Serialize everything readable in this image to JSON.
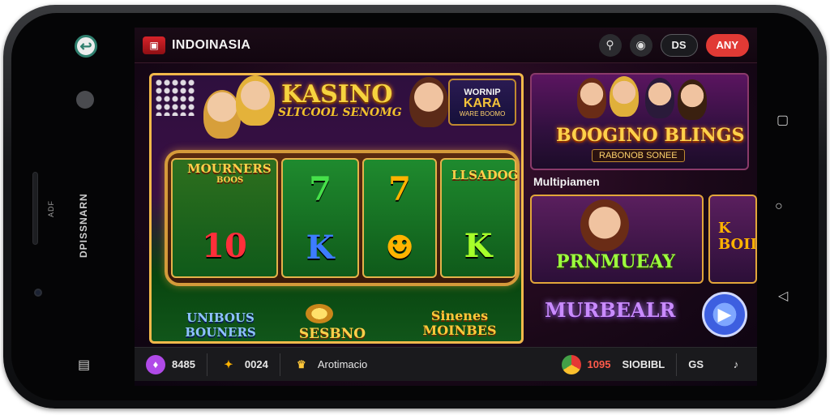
{
  "colors": {
    "accent_red": "#e13a35",
    "gold": "#f6d33f",
    "frame": "#f2b94a",
    "screen_bg": "#1a0818"
  },
  "device": {
    "left_side_text": "DPISSNARN",
    "left_small_text": "ADF",
    "icons": [
      "home-button-icon",
      "apple-logo-icon",
      "speaker-grille",
      "front-camera-icon",
      "menu-glyph-icon"
    ],
    "right_icons": [
      "square-nav-icon",
      "circle-nav-icon",
      "back-nav-icon"
    ]
  },
  "topbar": {
    "brand": "INDOINASIA",
    "search_icon": "search-icon",
    "record_icon": "record-icon",
    "lang_label": "DS",
    "action_label": "ANY"
  },
  "main_slot": {
    "title": "KASINO",
    "subtitle": "SLTCOOL SENOMG",
    "badge": {
      "line1": "WORNIP",
      "line2": "KARA",
      "line3": "WARE BOOMO"
    },
    "reel_left_label": "MOURNERS",
    "reel_left_sub": "BOOS",
    "reel_right_label": "LLSADOG",
    "reels": [
      {
        "top": "",
        "bottom": "10"
      },
      {
        "top": "7",
        "bottom": "K"
      },
      {
        "top": "7",
        "bottom": ""
      },
      {
        "top": "",
        "bottom": "K"
      }
    ],
    "lower_left": "UNIBOUS\nBOUNERS",
    "lower_center": "SESBNO",
    "lower_right": "Sinenes\nMOINBES"
  },
  "feature_card": {
    "title": "BOOGINO BLINGS",
    "subtitle": "RABONOB SONEE"
  },
  "section_title": "Multipiamen",
  "mp_cards": [
    {
      "label": "PRNMUEAY"
    },
    {
      "label": "K\nBOIL"
    }
  ],
  "bottom_promo": "MURBEALR",
  "fab_icon": "play-icon",
  "bottombar": {
    "items": [
      {
        "icon": "gem-icon",
        "value": "8485"
      },
      {
        "icon": "coins-icon",
        "value": "0024"
      },
      {
        "icon": "trophy-icon",
        "value": "Arotimacio"
      },
      {
        "icon": "chrome-icon",
        "value": "1095"
      },
      {
        "icon": "",
        "value": "SIOBIBL"
      },
      {
        "icon": "",
        "value": "GS"
      },
      {
        "icon": "music-icon",
        "value": ""
      }
    ]
  }
}
